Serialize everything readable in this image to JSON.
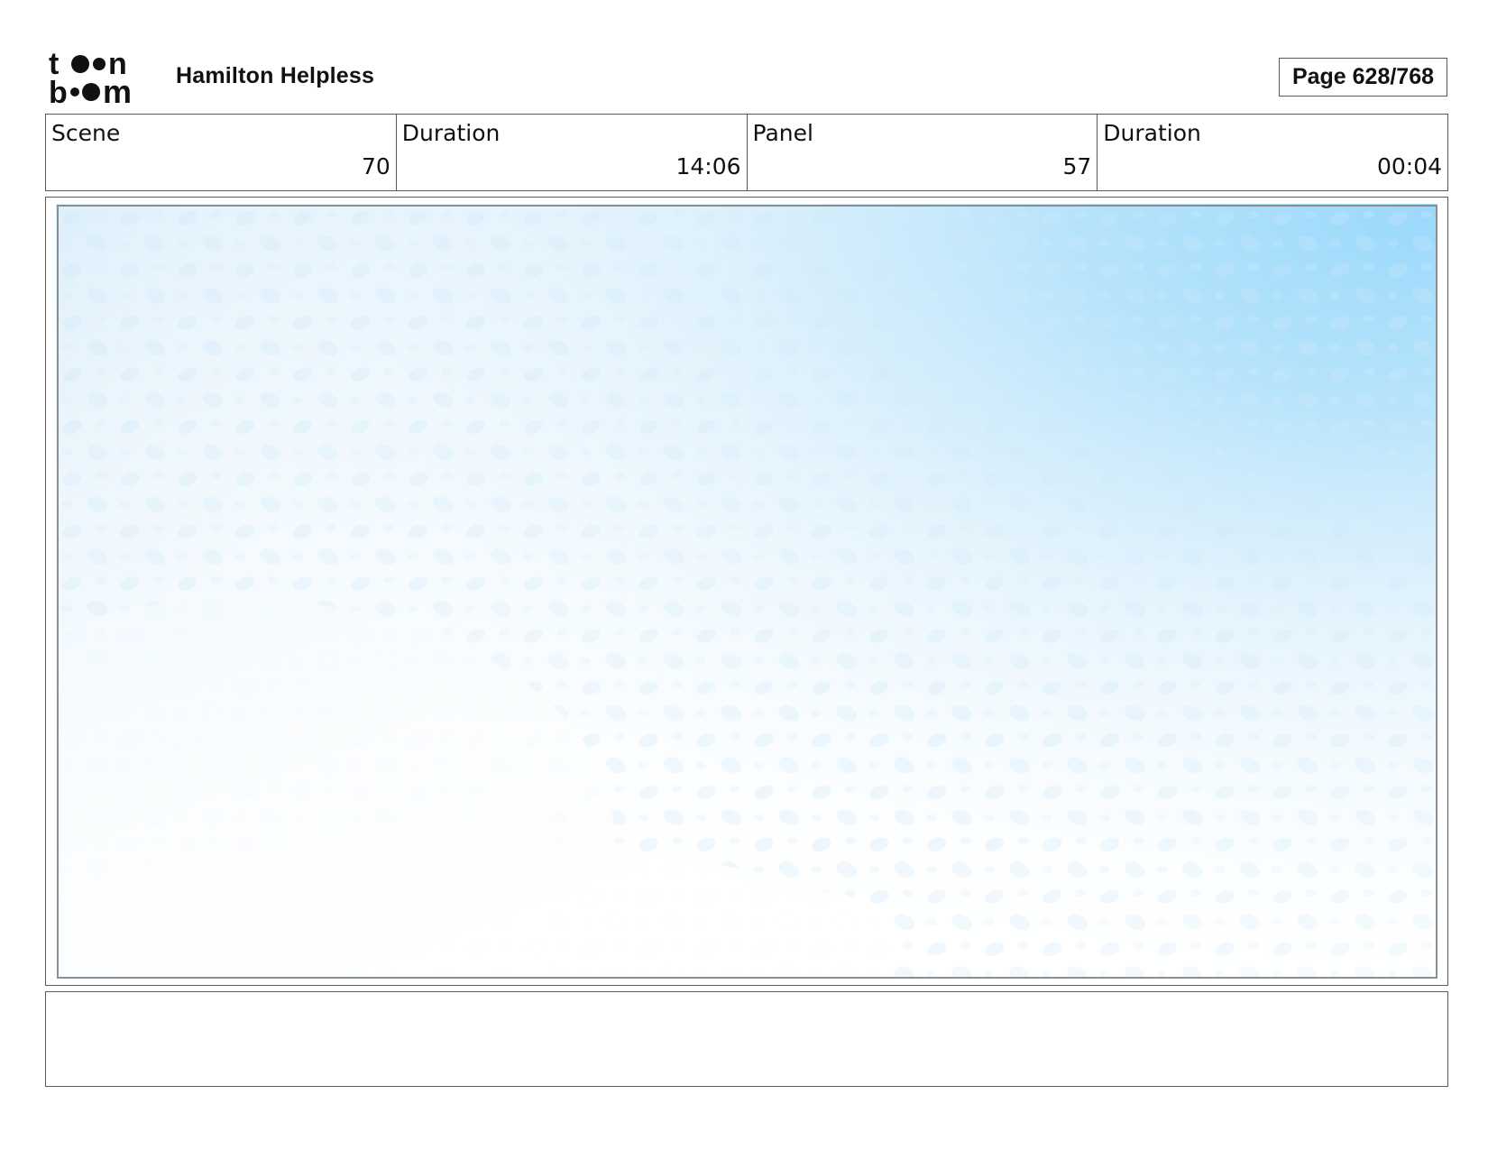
{
  "header": {
    "logo_text": "toon boom",
    "project_title": "Hamilton Helpless",
    "page_label": "Page 628/768"
  },
  "info": {
    "scene_label": "Scene",
    "scene_value": "70",
    "scene_duration_label": "Duration",
    "scene_duration_value": "14:06",
    "panel_label": "Panel",
    "panel_value": "57",
    "panel_duration_label": "Duration",
    "panel_duration_value": "00:04"
  },
  "panel": {
    "sky_color": "#9ad8fb",
    "texture_color": "#cfe9f9"
  },
  "notes": {
    "text": ""
  }
}
